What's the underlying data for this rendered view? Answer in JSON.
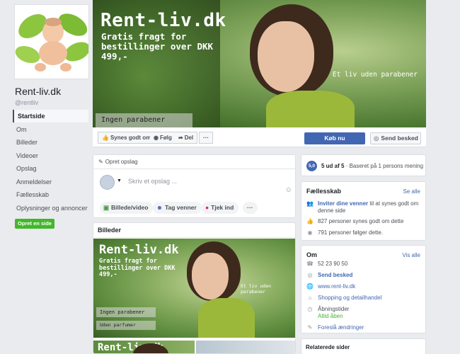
{
  "page": {
    "name": "Rent-liv.dk",
    "handle": "@rentliv"
  },
  "nav": {
    "items": [
      {
        "label": "Startside",
        "active": true
      },
      {
        "label": "Om"
      },
      {
        "label": "Billeder"
      },
      {
        "label": "Videoer"
      },
      {
        "label": "Opslag"
      },
      {
        "label": "Anmeldelser"
      },
      {
        "label": "Fællesskab"
      },
      {
        "label": "Oplysninger og annoncer"
      }
    ],
    "create_page": "Opret en side"
  },
  "cover": {
    "title": "Rent-liv.dk",
    "subtitle": "Gratis fragt for bestillinger over DKK 499,-",
    "tagline": "Et liv uden parabener",
    "label": "Ingen parabener"
  },
  "actions": {
    "like": "Synes godt om",
    "follow": "Følg",
    "share": "Del",
    "more": "···",
    "buy": "Køb nu",
    "message": "Send besked"
  },
  "composer": {
    "header": "Opret opslag",
    "placeholder": "Skriv et opslag ...",
    "photo": "Billede/video",
    "tag": "Tag venner",
    "checkin": "Tjek ind",
    "more": "···"
  },
  "photos": {
    "header": "Billeder",
    "title": "Rent-liv.dk",
    "subtitle": "Gratis fragt for bestillinger over DKK 499,-",
    "tagline": "Et liv uden parabener",
    "label1": "Ingen parabener",
    "label2": "Uden parfumer",
    "thumb_title": "Rent-liv.dk"
  },
  "rating": {
    "badge": "5,0",
    "score": "5 ud af 5",
    "basis": "· Baseret på 1 persons mening"
  },
  "community": {
    "title": "Fællesskab",
    "see_all": "Se alle",
    "invite_link": "Inviter dine venner",
    "invite_rest": " til at synes godt om",
    "invite_line2": "denne side",
    "likes": "827 personer synes godt om dette",
    "follows": "791 personer følger dette."
  },
  "about": {
    "title": "Om",
    "see_all": "Vis alle",
    "phone": "52 23 90 50",
    "message": "Send besked",
    "website": "www.rent-liv.dk",
    "category": "Shopping og detailhandel",
    "hours": "Åbningstider",
    "open": "Altid åben",
    "suggest": "Foreslå ændringer"
  },
  "related": {
    "title": "Relaterede sider"
  }
}
